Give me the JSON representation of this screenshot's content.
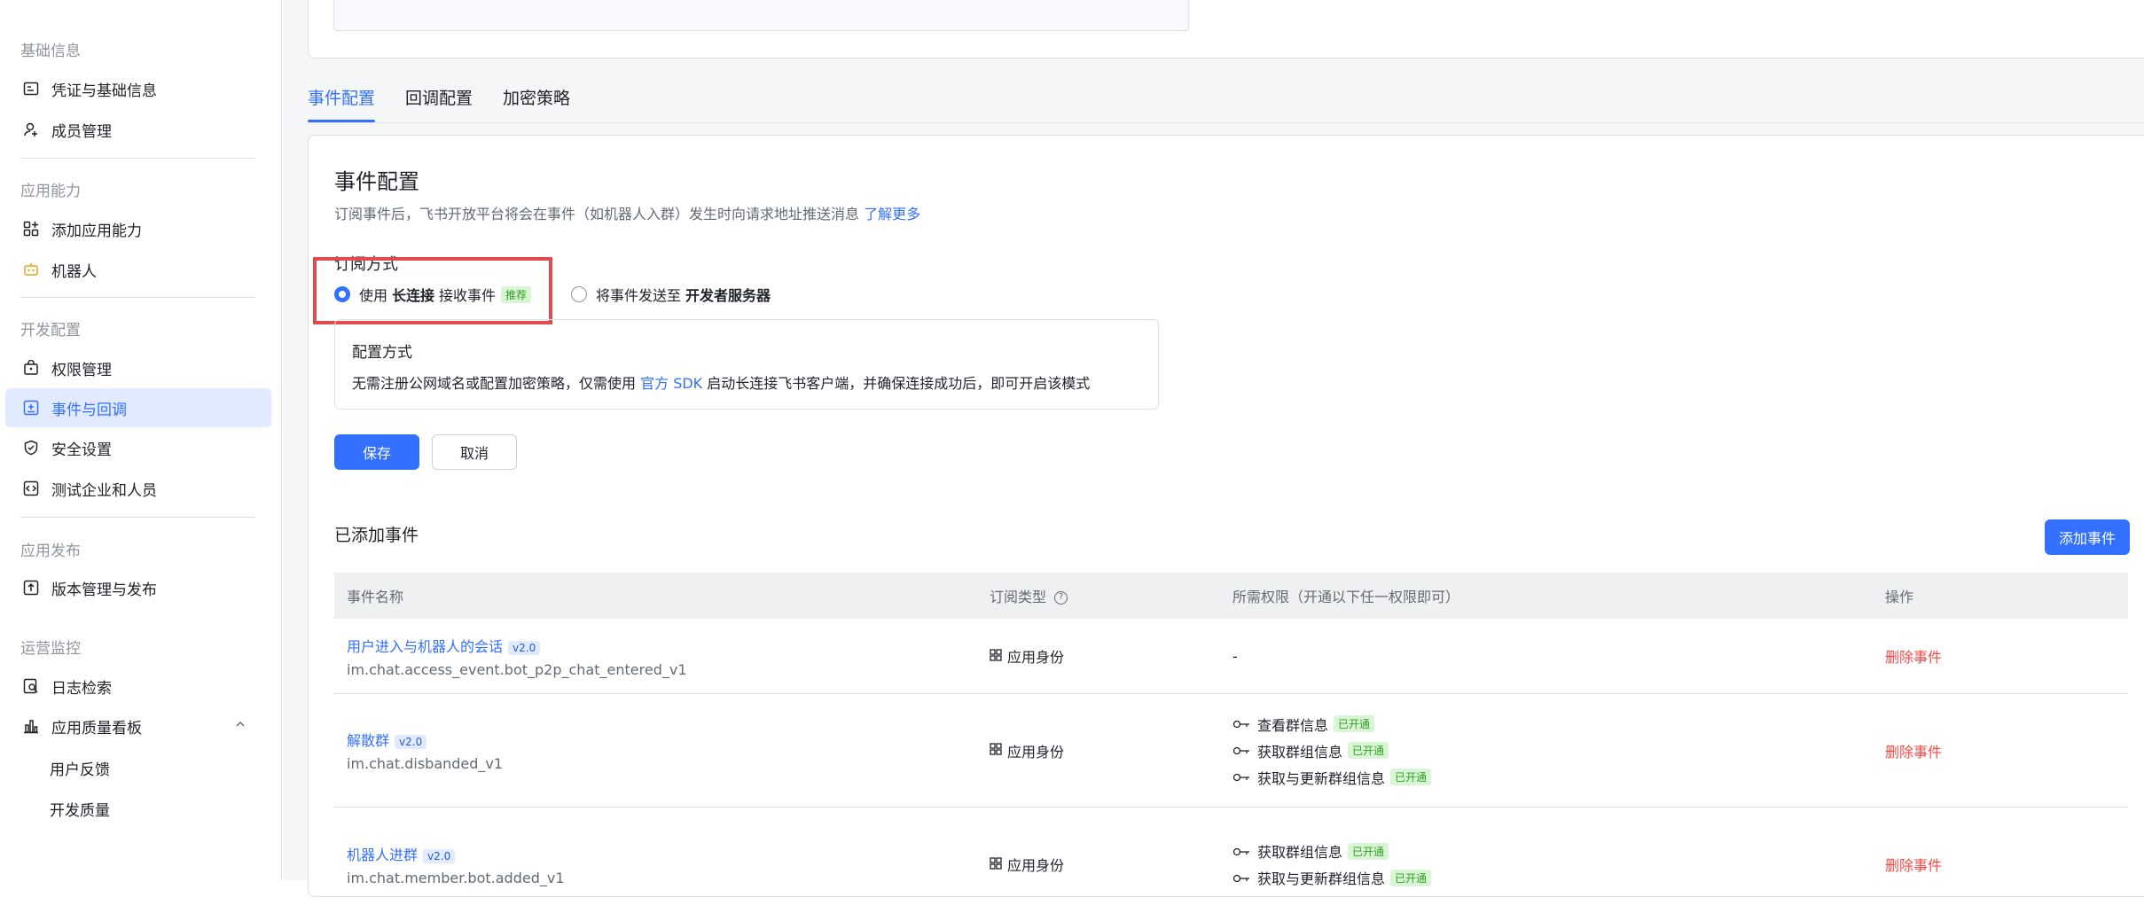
{
  "sidebar": {
    "groups": [
      {
        "title": "基础信息",
        "items": [
          "凭证与基础信息",
          "成员管理"
        ]
      },
      {
        "title": "应用能力",
        "items": [
          "添加应用能力",
          "机器人"
        ]
      },
      {
        "title": "开发配置",
        "items": [
          "权限管理",
          "事件与回调",
          "安全设置",
          "测试企业和人员"
        ]
      },
      {
        "title": "应用发布",
        "items": [
          "版本管理与发布"
        ]
      },
      {
        "title": "运营监控",
        "items": [
          "日志检索",
          "应用质量看板"
        ]
      }
    ],
    "sub_items": [
      "用户反馈",
      "开发质量"
    ]
  },
  "tabs": [
    "事件配置",
    "回调配置",
    "加密策略"
  ],
  "event_config": {
    "title": "事件配置",
    "desc": "订阅事件后，飞书开放平台将会在事件（如机器人入群）发生时向请求地址推送消息",
    "learn_more": "了解更多",
    "subscribe_label": "订阅方式",
    "option1_pre": "使用",
    "option1_bold": "长连接",
    "option1_post": "接收事件",
    "option1_tag": "推荐",
    "option2_pre": "将事件发送至",
    "option2_bold": "开发者服务器",
    "config_title": "配置方式",
    "config_text_pre": "无需注册公网域名或配置加密策略，仅需使用",
    "config_link": "官方 SDK",
    "config_text_post": "启动长连接飞书客户端，并确保连接成功后，即可开启该模式",
    "save": "保存",
    "cancel": "取消"
  },
  "added": {
    "title": "已添加事件",
    "add_button": "添加事件",
    "headers": [
      "事件名称",
      "订阅类型",
      "所需权限（开通以下任一权限即可）",
      "操作"
    ],
    "rows": [
      {
        "name": "用户进入与机器人的会话",
        "version": "v2.0",
        "key": "im.chat.access_event.bot_p2p_chat_entered_v1",
        "type": "应用身份",
        "perms": [
          "-"
        ],
        "action": "删除事件"
      },
      {
        "name": "解散群",
        "version": "v2.0",
        "key": "im.chat.disbanded_v1",
        "type": "应用身份",
        "perms": [
          "查看群信息",
          "获取群组信息",
          "获取与更新群组信息"
        ],
        "perm_tag": "已开通",
        "action": "删除事件"
      },
      {
        "name": "机器人进群",
        "version": "v2.0",
        "key": "im.chat.member.bot.added_v1",
        "type": "应用身份",
        "perms": [
          "获取群组信息",
          "获取与更新群组信息"
        ],
        "perm_tag": "已开通",
        "action": "删除事件"
      }
    ]
  },
  "colors": {
    "accent": "#3370ff",
    "danger": "#f54a45",
    "highlight_box": "#e24b4b"
  }
}
